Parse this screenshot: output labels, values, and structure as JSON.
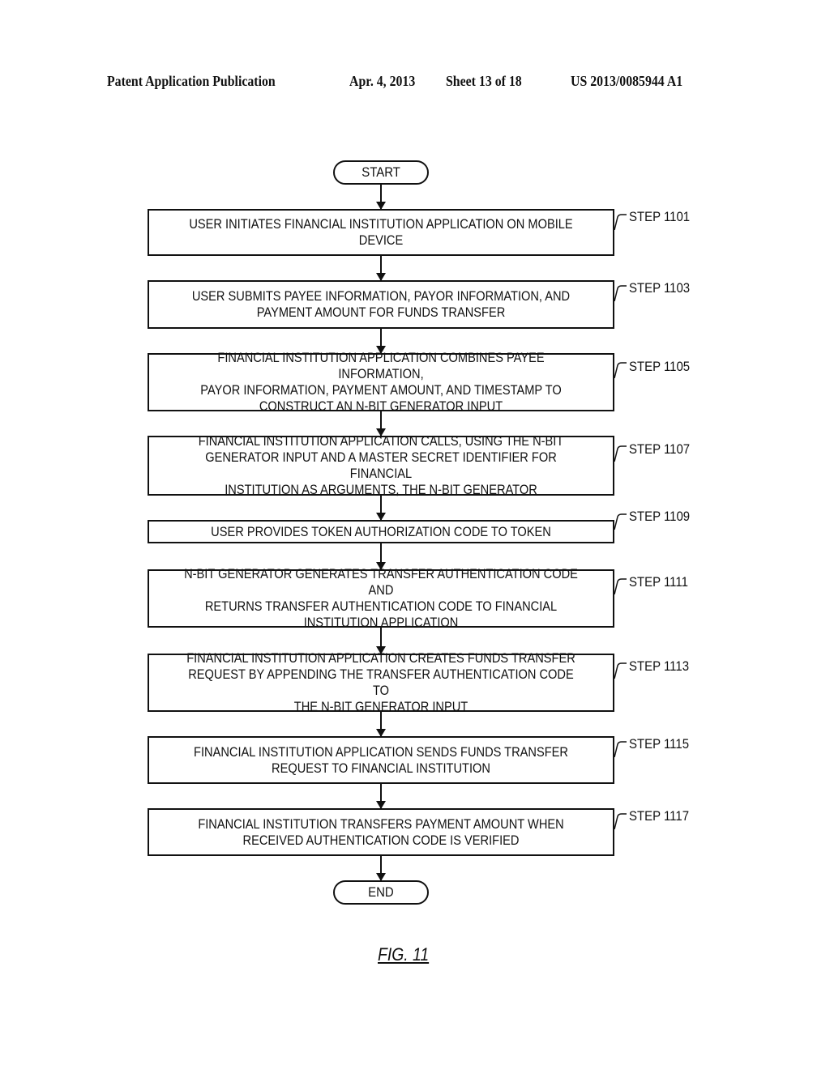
{
  "header": {
    "publication": "Patent Application Publication",
    "date": "Apr. 4, 2013",
    "sheet": "Sheet 13 of 18",
    "number": "US 2013/0085944 A1"
  },
  "flowchart": {
    "start_label": "START",
    "end_label": "END",
    "steps": [
      {
        "label": "STEP 1101",
        "text": "USER INITIATES FINANCIAL INSTITUTION APPLICATION ON MOBILE\nDEVICE"
      },
      {
        "label": "STEP 1103",
        "text": "USER SUBMITS PAYEE INFORMATION, PAYOR INFORMATION, AND\nPAYMENT AMOUNT FOR FUNDS TRANSFER"
      },
      {
        "label": "STEP 1105",
        "text": "FINANCIAL INSTITUTION APPLICATION COMBINES PAYEE INFORMATION,\nPAYOR INFORMATION, PAYMENT AMOUNT, AND TIMESTAMP TO\nCONSTRUCT AN N-BIT GENERATOR INPUT"
      },
      {
        "label": "STEP 1107",
        "text": "FINANCIAL INSTITUTION APPLICATION CALLS, USING THE N-BIT\nGENERATOR INPUT AND A MASTER SECRET IDENTIFIER FOR FINANCIAL\nINSTITUTION AS ARGUMENTS, THE N-BIT GENERATOR"
      },
      {
        "label": "STEP 1109",
        "text": "USER PROVIDES TOKEN AUTHORIZATION CODE TO TOKEN"
      },
      {
        "label": "STEP 1111",
        "text": "N-BIT GENERATOR GENERATES TRANSFER AUTHENTICATION CODE AND\nRETURNS TRANSFER AUTHENTICATION CODE TO FINANCIAL\nINSTITUTION APPLICATION"
      },
      {
        "label": "STEP 1113",
        "text": "FINANCIAL INSTITUTION APPLICATION CREATES FUNDS TRANSFER\nREQUEST BY APPENDING THE TRANSFER AUTHENTICATION CODE TO\nTHE N-BIT GENERATOR INPUT"
      },
      {
        "label": "STEP 1115",
        "text": "FINANCIAL INSTITUTION APPLICATION SENDS FUNDS TRANSFER\nREQUEST TO FINANCIAL INSTITUTION"
      },
      {
        "label": "STEP 1117",
        "text": "FINANCIAL INSTITUTION TRANSFERS PAYMENT AMOUNT WHEN\nRECEIVED AUTHENTICATION CODE IS VERIFIED"
      }
    ]
  },
  "figure_caption": "FIG. 11"
}
